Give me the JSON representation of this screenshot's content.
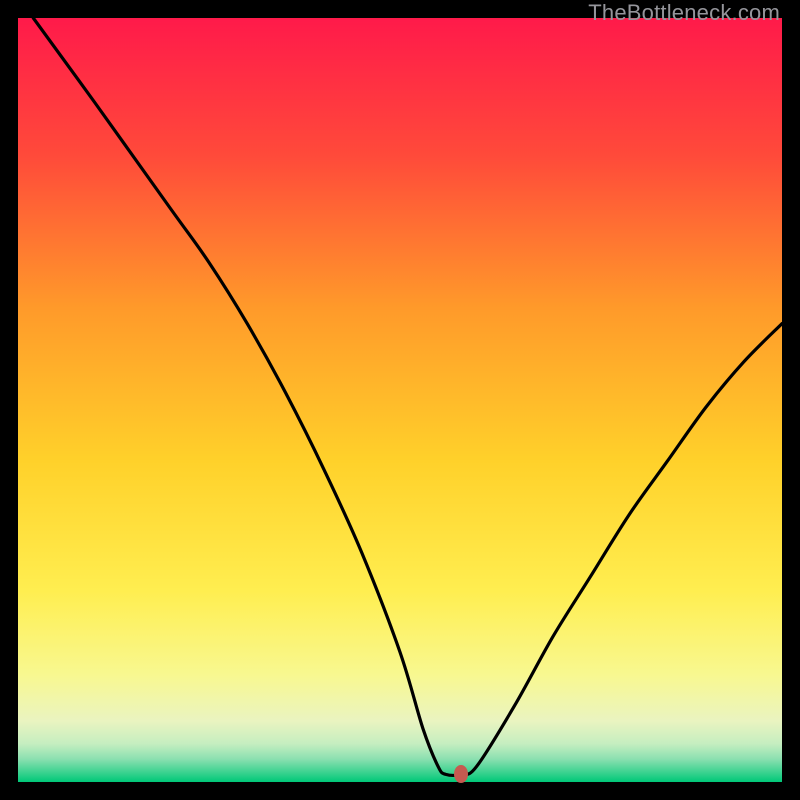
{
  "watermark": "TheBottleneck.com",
  "colors": {
    "frame": "#000000",
    "gradient_top": "#ff1a4a",
    "gradient_mid1": "#ff6a2a",
    "gradient_mid2": "#ffd12a",
    "gradient_mid3": "#ffee60",
    "gradient_mid4": "#f4f6a8",
    "gradient_mid5": "#c5eec0",
    "gradient_bottom": "#00c878",
    "curve": "#000000",
    "marker": "#c55a50"
  },
  "chart_data": {
    "type": "line",
    "title": "",
    "xlabel": "",
    "ylabel": "",
    "xlim": [
      0,
      100
    ],
    "ylim": [
      0,
      100
    ],
    "grid": false,
    "series": [
      {
        "name": "bottleneck-curve",
        "x": [
          2,
          10,
          20,
          25,
          30,
          35,
          40,
          45,
          50,
          53,
          55,
          56,
          58,
          60,
          65,
          70,
          75,
          80,
          85,
          90,
          95,
          100
        ],
        "values": [
          100,
          89,
          75,
          68,
          60,
          51,
          41,
          30,
          17,
          7,
          2,
          1,
          1,
          2,
          10,
          19,
          27,
          35,
          42,
          49,
          55,
          60
        ]
      }
    ],
    "annotations": [
      {
        "name": "optimal-point",
        "x": 58,
        "y": 1
      }
    ]
  }
}
